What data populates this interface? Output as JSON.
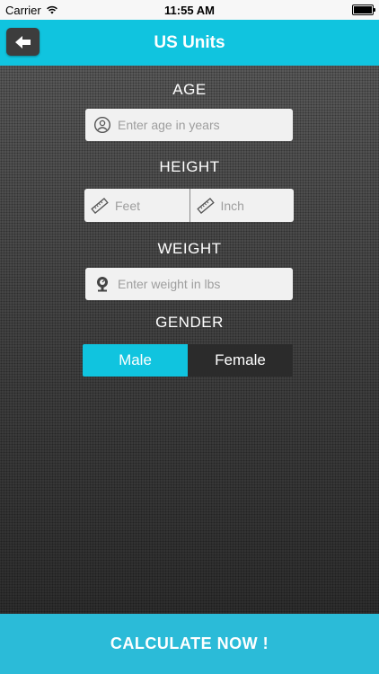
{
  "status_bar": {
    "carrier": "Carrier",
    "time": "11:55 AM"
  },
  "header": {
    "title": "US Units",
    "back_icon": "arrow-left-icon"
  },
  "age": {
    "label": "AGE",
    "placeholder": "Enter age in years",
    "icon": "person-icon"
  },
  "height": {
    "label": "HEIGHT",
    "feet_placeholder": "Feet",
    "inch_placeholder": "Inch",
    "icon": "ruler-icon"
  },
  "weight": {
    "label": "WEIGHT",
    "placeholder": "Enter weight in lbs",
    "icon": "scale-icon"
  },
  "gender": {
    "label": "GENDER",
    "options": [
      "Male",
      "Female"
    ],
    "selected": "Male"
  },
  "calculate": {
    "label": "CALCULATE NOW !"
  },
  "colors": {
    "accent": "#10c4df",
    "button": "#2bbbd8",
    "dark": "#2b2b2b"
  }
}
